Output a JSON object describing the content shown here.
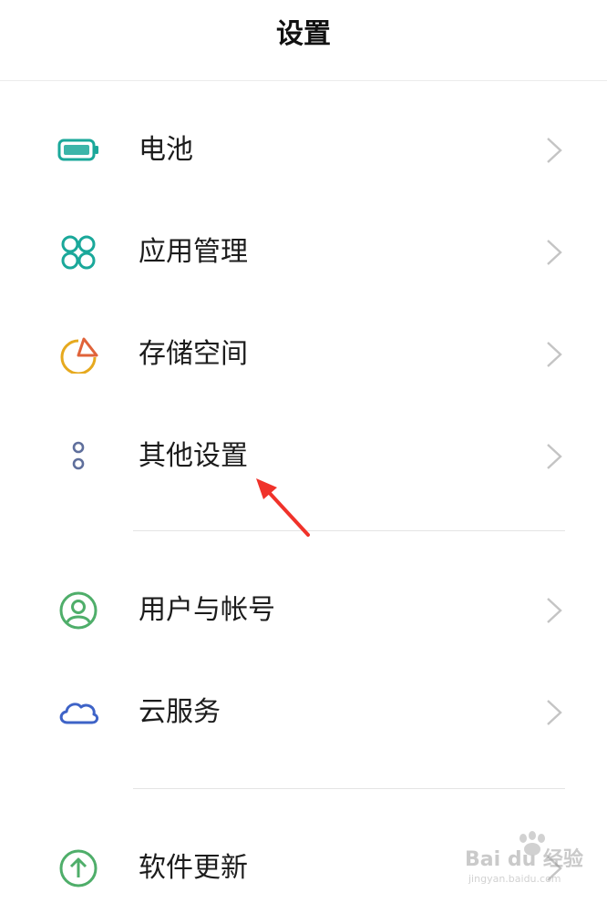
{
  "header": {
    "title": "设置"
  },
  "settings": [
    {
      "label": "电池",
      "icon": "battery-icon",
      "color": "#1aa89a"
    },
    {
      "label": "应用管理",
      "icon": "apps-grid-icon",
      "color": "#1aa89a"
    },
    {
      "label": "存储空间",
      "icon": "storage-pie-icon",
      "color": "#e6a91e"
    },
    {
      "label": "其他设置",
      "icon": "more-dots-icon",
      "color": "#5f6f9c"
    },
    {
      "label": "用户与帐号",
      "icon": "user-account-icon",
      "color": "#4fae6a"
    },
    {
      "label": "云服务",
      "icon": "cloud-icon",
      "color": "#3e63c7"
    },
    {
      "label": "软件更新",
      "icon": "update-arrow-icon",
      "color": "#4fae6a"
    }
  ],
  "annotation": {
    "arrow_color": "#f0322a"
  },
  "watermark": {
    "brand": "Bai du 经验",
    "url": "jingyan.baidu.com"
  }
}
